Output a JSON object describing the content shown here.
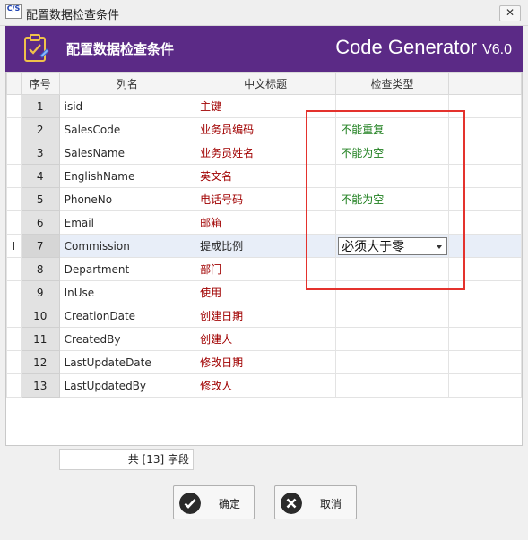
{
  "window": {
    "title": "配置数据检查条件",
    "logo_text_top": "C/S",
    "close_glyph": "✕"
  },
  "banner": {
    "title": "配置数据检查条件",
    "brand_name": "Code Generator",
    "brand_version": "V6.0",
    "color": "#5b2a86"
  },
  "grid": {
    "columns": [
      "序号",
      "列名",
      "中文标题",
      "检查类型"
    ],
    "rows": [
      {
        "seq": "1",
        "name": "isid",
        "cn": "主键",
        "check": ""
      },
      {
        "seq": "2",
        "name": "SalesCode",
        "cn": "业务员编码",
        "check": "不能重复"
      },
      {
        "seq": "3",
        "name": "SalesName",
        "cn": "业务员姓名",
        "check": "不能为空"
      },
      {
        "seq": "4",
        "name": "EnglishName",
        "cn": "英文名",
        "check": ""
      },
      {
        "seq": "5",
        "name": "PhoneNo",
        "cn": "电话号码",
        "check": "不能为空"
      },
      {
        "seq": "6",
        "name": "Email",
        "cn": "邮箱",
        "check": ""
      },
      {
        "seq": "7",
        "name": "Commission",
        "cn": "提成比例",
        "check": "必须大于零"
      },
      {
        "seq": "8",
        "name": "Department",
        "cn": "部门",
        "check": ""
      },
      {
        "seq": "9",
        "name": "InUse",
        "cn": "使用",
        "check": ""
      },
      {
        "seq": "10",
        "name": "CreationDate",
        "cn": "创建日期",
        "check": ""
      },
      {
        "seq": "11",
        "name": "CreatedBy",
        "cn": "创建人",
        "check": ""
      },
      {
        "seq": "12",
        "name": "LastUpdateDate",
        "cn": "修改日期",
        "check": ""
      },
      {
        "seq": "13",
        "name": "LastUpdatedBy",
        "cn": "修改人",
        "check": ""
      }
    ],
    "selected_row_indicator": "I",
    "check_text_color": "#208020",
    "cn_text_color": "#a00000",
    "highlight_color": "#e4322d"
  },
  "footer": {
    "field_count": "共 [13] 字段"
  },
  "buttons": {
    "ok_label": "确定",
    "cancel_label": "取消"
  }
}
